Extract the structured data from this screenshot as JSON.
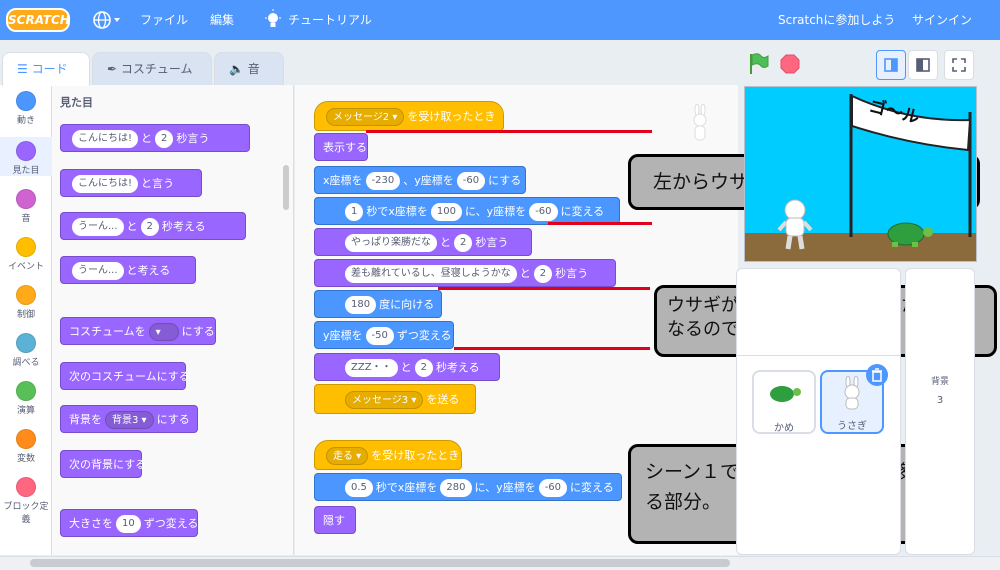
{
  "menubar": {
    "logo": "SCRATCH",
    "file": "ファイル",
    "edit": "編集",
    "tutorial": "チュートリアル",
    "join": "Scratchに参加しよう",
    "signin": "サインイン"
  },
  "tabs": {
    "code": "コード",
    "costume": "コスチューム",
    "sound": "音"
  },
  "categories": [
    {
      "label": "動き",
      "color": "#4c97ff"
    },
    {
      "label": "見た目",
      "color": "#9966ff"
    },
    {
      "label": "音",
      "color": "#cf63cf"
    },
    {
      "label": "イベント",
      "color": "#ffbf00"
    },
    {
      "label": "制御",
      "color": "#ffab19"
    },
    {
      "label": "調べる",
      "color": "#5cb1d6"
    },
    {
      "label": "演算",
      "color": "#59c059"
    },
    {
      "label": "変数",
      "color": "#ff8c1a"
    },
    {
      "label": "ブロック定義",
      "color": "#ff6680"
    }
  ],
  "palette": {
    "section": "見た目",
    "b1": {
      "text": "こんにちは!",
      "mid": "と",
      "num": "2",
      "end": "秒言う"
    },
    "b2": {
      "text": "こんにちは!",
      "end": "と言う"
    },
    "b3": {
      "text": "うーん...",
      "mid": "と",
      "num": "2",
      "end": "秒考える"
    },
    "b4": {
      "text": "うーん...",
      "end": "と考える"
    },
    "b5": {
      "pre": "コスチュームを",
      "end": "にする"
    },
    "b6": "次のコスチュームにする",
    "b7": {
      "pre": "背景を",
      "dd": "背景3",
      "end": "にする"
    },
    "b8": "次の背景にする",
    "b9": {
      "pre": "大きさを",
      "num": "10",
      "end": "ずつ変える"
    }
  },
  "script1": {
    "hat": {
      "dd": "メッセージ2",
      "end": "を受け取ったとき"
    },
    "show": "表示する",
    "goto": {
      "pre": "x座標を",
      "x": "-230",
      "mid": "、y座標を",
      "y": "-60",
      "end": "にする"
    },
    "glide": {
      "secs": "1",
      "pre": "秒でx座標を",
      "x": "100",
      "mid": "に、y座標を",
      "y": "-60",
      "end": "に変える"
    },
    "say1": {
      "text": "やっぱり楽勝だな",
      "mid": "と",
      "num": "2",
      "end": "秒言う"
    },
    "say2": {
      "text": "差も離れているし、昼寝しようかな",
      "mid": "と",
      "num": "2",
      "end": "秒言う"
    },
    "point": {
      "num": "180",
      "end": "度に向ける"
    },
    "changey": {
      "pre": "y座標を",
      "num": "-50",
      "end": "ずつ変える"
    },
    "think": {
      "text": "ZZZ・・",
      "mid": "と",
      "num": "2",
      "end": "秒考える"
    },
    "send": {
      "dd": "メッセージ3",
      "end": "を送る"
    }
  },
  "script2": {
    "hat": {
      "dd": "走る",
      "end": "を受け取ったとき"
    },
    "glide": {
      "secs": "0.5",
      "pre": "秒でx座標を",
      "x": "280",
      "mid": "に、y座標を",
      "y": "-60",
      "end": "に変える"
    },
    "hide": "隠す"
  },
  "callouts": {
    "c1": "左からウサギが登場する部分",
    "c2": "ウサギが横になる部分。浮いた状態になるので下に少し移動",
    "c3": "シーン１でカメと同時に右に移動する部分。"
  },
  "stage": {
    "flag_text": "ゴ～ル"
  },
  "sprites": [
    {
      "name": "かめ"
    },
    {
      "name": "うさぎ"
    }
  ],
  "backdrop": {
    "label": "背景",
    "count": "3"
  },
  "colors": {
    "accent": "#4d97ff",
    "looks": "#9966ff",
    "motion": "#4c97ff",
    "events": "#ffbf00"
  }
}
